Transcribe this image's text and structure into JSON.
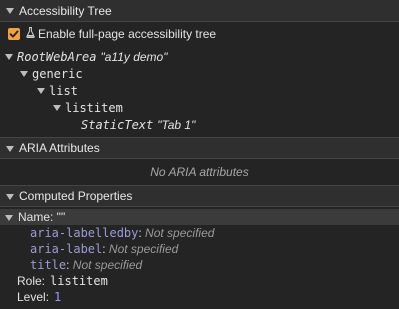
{
  "sections": {
    "accessibility_tree": {
      "title": "Accessibility Tree"
    },
    "aria_attributes": {
      "title": "ARIA Attributes",
      "empty_message": "No ARIA attributes"
    },
    "computed_properties": {
      "title": "Computed Properties"
    }
  },
  "full_page_toggle": {
    "label": "Enable full-page accessibility tree",
    "checked": true
  },
  "tree": {
    "root": {
      "role": "RootWebArea",
      "name": "\"a11y demo\""
    },
    "generic": {
      "role": "generic"
    },
    "list": {
      "role": "list"
    },
    "listitem": {
      "role": "listitem"
    },
    "statictext": {
      "role": "StaticText",
      "name": "\"Tab 1\""
    }
  },
  "computed": {
    "name_header": "Name: \"\"",
    "props": [
      {
        "key": "aria-labelledby",
        "value": "Not specified"
      },
      {
        "key": "aria-label",
        "value": "Not specified"
      },
      {
        "key": "title",
        "value": "Not specified"
      }
    ],
    "role_label": "Role:",
    "role_value": "listitem",
    "level_label": "Level:",
    "level_value": "1"
  },
  "colors": {
    "background": "#242424",
    "header": "#2f2f2f",
    "checkbox": "#f2a23b",
    "prop_key": "#9b9bd6",
    "level_value": "#9b9bff"
  }
}
